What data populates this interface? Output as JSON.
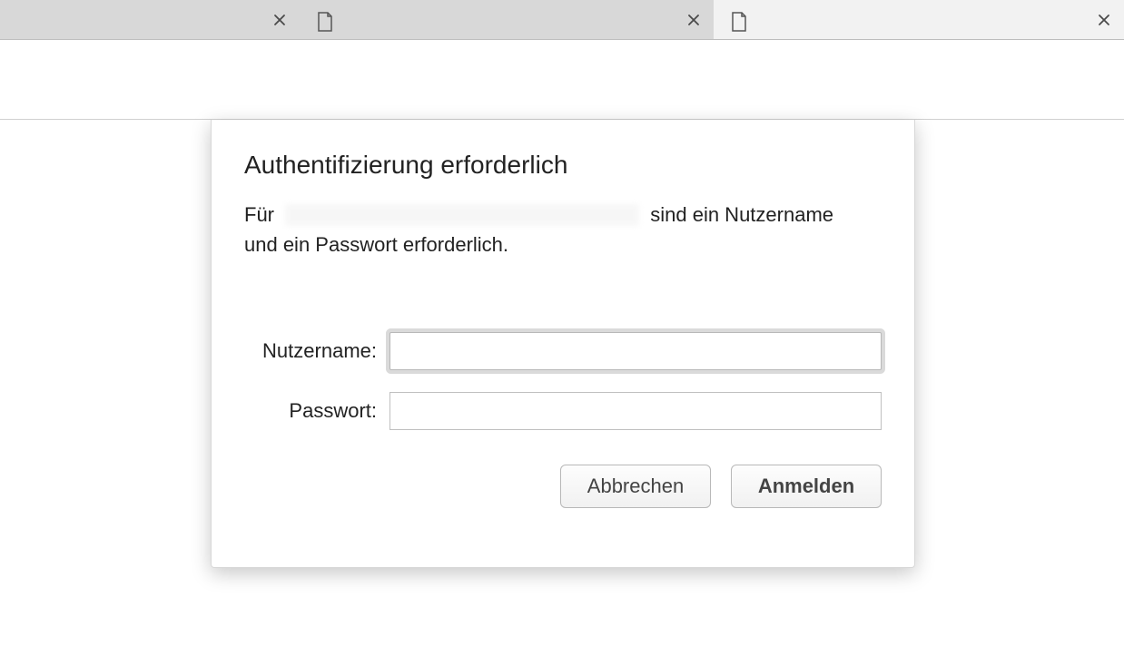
{
  "tabs": [
    {
      "has_icon": false
    },
    {
      "has_icon": true
    },
    {
      "has_icon": true
    }
  ],
  "dialog": {
    "title": "Authentifizierung erforderlich",
    "message_prefix": "Für ",
    "message_suffix1": " sind ein Nutzername",
    "message_line2": "und ein Passwort erforderlich.",
    "username_label": "Nutzername:",
    "password_label": "Passwort:",
    "username_value": "",
    "password_value": "",
    "cancel_label": "Abbrechen",
    "submit_label": "Anmelden"
  }
}
